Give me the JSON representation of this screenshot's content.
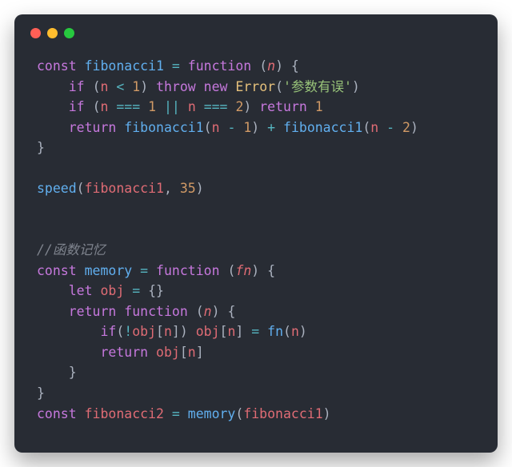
{
  "window": {
    "traffic_lights": [
      "close",
      "minimize",
      "zoom"
    ]
  },
  "code": {
    "lines": [
      "<span class='c-kw'>const</span> <span class='c-fn'>fibonacci1</span> <span class='c-op'>=</span> <span class='c-kw'>function</span> <span class='c-def'>(</span><span class='c-param'>n</span><span class='c-def'>) {</span>",
      "    <span class='c-kw'>if</span> <span class='c-def'>(</span><span class='c-prop'>n</span> <span class='c-op'>&lt;</span> <span class='c-num'>1</span><span class='c-def'>)</span> <span class='c-kw'>throw</span> <span class='c-kw'>new</span> <span class='c-id'>Error</span><span class='c-def'>(</span><span class='c-str'>'参数有误'</span><span class='c-def'>)</span>",
      "    <span class='c-kw'>if</span> <span class='c-def'>(</span><span class='c-prop'>n</span> <span class='c-op'>===</span> <span class='c-num'>1</span> <span class='c-op'>||</span> <span class='c-prop'>n</span> <span class='c-op'>===</span> <span class='c-num'>2</span><span class='c-def'>)</span> <span class='c-kw'>return</span> <span class='c-num'>1</span>",
      "    <span class='c-kw'>return</span> <span class='c-fn'>fibonacci1</span><span class='c-def'>(</span><span class='c-prop'>n</span> <span class='c-op'>-</span> <span class='c-num'>1</span><span class='c-def'>)</span> <span class='c-op'>+</span> <span class='c-fn'>fibonacci1</span><span class='c-def'>(</span><span class='c-prop'>n</span> <span class='c-op'>-</span> <span class='c-num'>2</span><span class='c-def'>)</span>",
      "<span class='c-def'>}</span>",
      "",
      "<span class='c-fn'>speed</span><span class='c-def'>(</span><span class='c-prop'>fibonacci1</span><span class='c-def'>,</span> <span class='c-num'>35</span><span class='c-def'>)</span>",
      "",
      "",
      "<span class='c-cmt'>//函数记忆</span>",
      "<span class='c-kw'>const</span> <span class='c-fn'>memory</span> <span class='c-op'>=</span> <span class='c-kw'>function</span> <span class='c-def'>(</span><span class='c-param'>fn</span><span class='c-def'>) {</span>",
      "    <span class='c-kw'>let</span> <span class='c-prop'>obj</span> <span class='c-op'>=</span> <span class='c-def'>{}</span>",
      "    <span class='c-kw'>return</span> <span class='c-kw'>function</span> <span class='c-def'>(</span><span class='c-param'>n</span><span class='c-def'>) {</span>",
      "        <span class='c-kw'>if</span><span class='c-def'>(</span><span class='c-op'>!</span><span class='c-prop'>obj</span><span class='c-def'>[</span><span class='c-prop'>n</span><span class='c-def'>])</span> <span class='c-prop'>obj</span><span class='c-def'>[</span><span class='c-prop'>n</span><span class='c-def'>]</span> <span class='c-op'>=</span> <span class='c-fn'>fn</span><span class='c-def'>(</span><span class='c-prop'>n</span><span class='c-def'>)</span>",
      "        <span class='c-kw'>return</span> <span class='c-prop'>obj</span><span class='c-def'>[</span><span class='c-prop'>n</span><span class='c-def'>]</span>",
      "    <span class='c-def'>}</span>",
      "<span class='c-def'>}</span>",
      "<span class='c-kw'>const</span> <span class='c-prop'>fibonacci2</span> <span class='c-op'>=</span> <span class='c-fn'>memory</span><span class='c-def'>(</span><span class='c-prop'>fibonacci1</span><span class='c-def'>)</span>"
    ]
  }
}
